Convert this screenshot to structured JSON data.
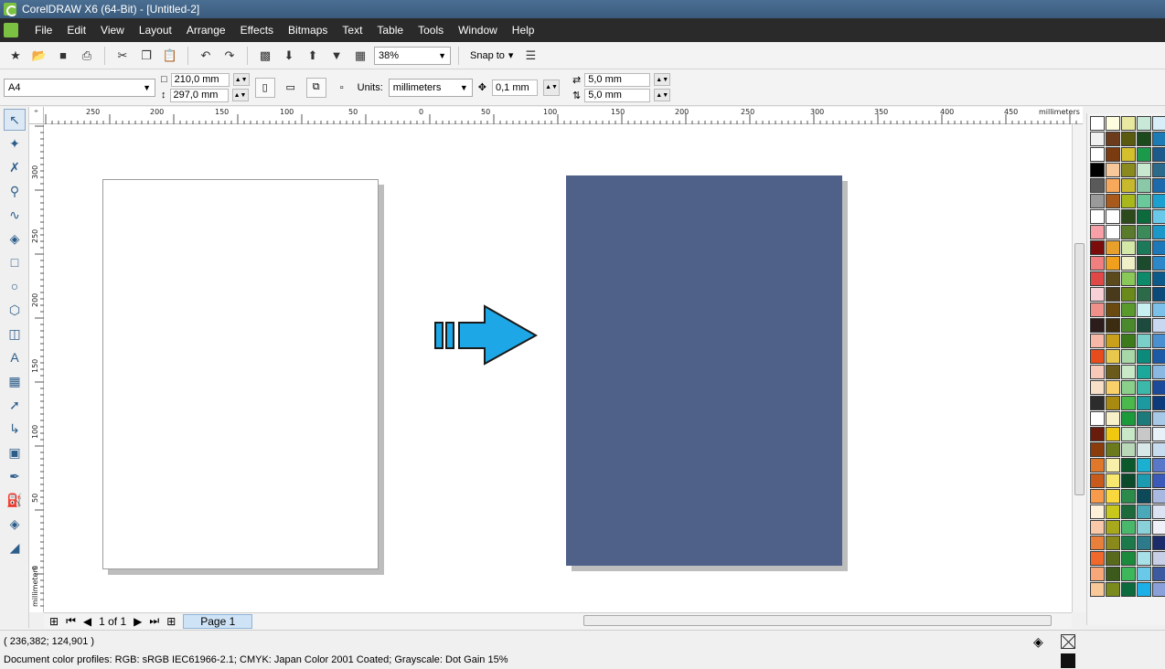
{
  "window": {
    "title": "CorelDRAW X6 (64-Bit) - [Untitled-2]"
  },
  "menu": [
    "File",
    "Edit",
    "View",
    "Layout",
    "Arrange",
    "Effects",
    "Bitmaps",
    "Text",
    "Table",
    "Tools",
    "Window",
    "Help"
  ],
  "toolbar": {
    "zoom": "38%",
    "snap_label": "Snap to"
  },
  "propbar": {
    "page_size": "A4",
    "width": "210,0 mm",
    "height": "297,0 mm",
    "units_label": "Units:",
    "units_value": "millimeters",
    "nudge": "0,1 mm",
    "dup_x": "5,0 mm",
    "dup_y": "5,0 mm"
  },
  "rulers": {
    "h_unit": "millimeters",
    "h_labels": [
      "250",
      "200",
      "150",
      "100",
      "50",
      "0",
      "50",
      "100",
      "150",
      "200",
      "250",
      "300",
      "350",
      "400",
      "450"
    ],
    "v_unit": "millimeters",
    "v_labels": [
      "300",
      "250",
      "200",
      "150",
      "100",
      "50",
      "0"
    ]
  },
  "pagenav": {
    "page_count": "1 of 1",
    "tab": "Page 1"
  },
  "status": {
    "coords": "( 236,382; 124,901 )",
    "profiles": "Document color profiles: RGB: sRGB IEC61966-2.1; CMYK: Japan Color 2001 Coated; Grayscale: Dot Gain 15%"
  },
  "colors": {
    "page_fill": "#4f6188",
    "arrow": "#1ea7e6"
  },
  "palette": [
    "#ffffff",
    "#fffde0",
    "#e8e8a0",
    "#c8e8d8",
    "#d8eef8",
    "#f0f0f0",
    "#6b3b1c",
    "#5a5a10",
    "#1c4a1c",
    "#1c7ab4",
    "#ffffff",
    "#7a3b10",
    "#d4c02c",
    "#1c9a4c",
    "#1c5a8c",
    "#000000",
    "#f7c89a",
    "#8a8a20",
    "#c8e8d0",
    "#2c6a8c",
    "#5a5a5a",
    "#f7a85a",
    "#c8b82c",
    "#8ac8a8",
    "#1c6aac",
    "#9a9a9a",
    "#a85a1c",
    "#a8b81c",
    "#6ac89a",
    "#1ca0d0",
    "#ffffff",
    "#ffffff",
    "#2c4a1c",
    "#0c6a3c",
    "#6ac8e8",
    "#f7a0a8",
    "#ffffff",
    "#5a7a2c",
    "#3c8a5a",
    "#1c98c8",
    "#7a0c0c",
    "#e8a02c",
    "#d4e8a8",
    "#1c7a5a",
    "#1c78b8",
    "#f08080",
    "#f0a01c",
    "#f0f0c8",
    "#1c4a2c",
    "#2c88c8",
    "#e04848",
    "#5a4a1c",
    "#8ac85a",
    "#0c8a6a",
    "#0c5a8a",
    "#f8d0d8",
    "#4a3a1c",
    "#6a8a1c",
    "#2c6a4a",
    "#0c4a7a",
    "#f0908a",
    "#6a4a10",
    "#5a9a2c",
    "#c8f0f0",
    "#7ac0e8",
    "#2c1c1c",
    "#3c2c10",
    "#4a8a2c",
    "#1c4a3c",
    "#c8d8f0",
    "#f8b8a8",
    "#c8a01c",
    "#3c7a1c",
    "#7ad0c8",
    "#4a90d0",
    "#e84c1c",
    "#e8c84c",
    "#a8d8a8",
    "#0c8a7a",
    "#1c5aa8",
    "#f8c8b8",
    "#6a5a1c",
    "#c8e8c8",
    "#1ca89a",
    "#8ab8e0",
    "#f8e0c8",
    "#f8d06a",
    "#8ad08a",
    "#3cb8a8",
    "#1c4a9a",
    "#2c2c2c",
    "#a88a10",
    "#4ab84a",
    "#1c9aa0",
    "#0c3a7a",
    "#ffffff",
    "#f8f0c8",
    "#1c9a3c",
    "#1c7a7a",
    "#a8c8e8",
    "#6a1c0c",
    "#f0c810",
    "#c8e8c8",
    "#c8c8c8",
    "#e8f0f8",
    "#8a3c0c",
    "#6a7a1c",
    "#b8d8b8",
    "#d8e8e8",
    "#c8dcf0",
    "#e0782c",
    "#f8f0a8",
    "#0c5a2c",
    "#1cb0d0",
    "#5a78c8",
    "#c85a1c",
    "#f8e870",
    "#0c4a2c",
    "#1c9ab0",
    "#3c5ab8",
    "#f89a4c",
    "#f8d83c",
    "#2c8a4a",
    "#0c4a5a",
    "#a8b8e0",
    "#fff0d8",
    "#c8c81c",
    "#1c6a3c",
    "#4aa8b8",
    "#dce4f4",
    "#f8c8a8",
    "#a8a81c",
    "#4ab86a",
    "#8ad0d8",
    "#f0f0f8",
    "#e8803c",
    "#8a8a1c",
    "#1c7a4a",
    "#2c7a8a",
    "#1c2c6a",
    "#f0682c",
    "#5a6a1c",
    "#1c8a3c",
    "#a8e0e8",
    "#c8d0e8",
    "#f8a878",
    "#3c5a1c",
    "#3cb85a",
    "#6ac8e8",
    "#3c5aa0",
    "#f8c898",
    "#7a8a1c",
    "#0c6a3c",
    "#1cb0e8",
    "#8aa0d8"
  ]
}
